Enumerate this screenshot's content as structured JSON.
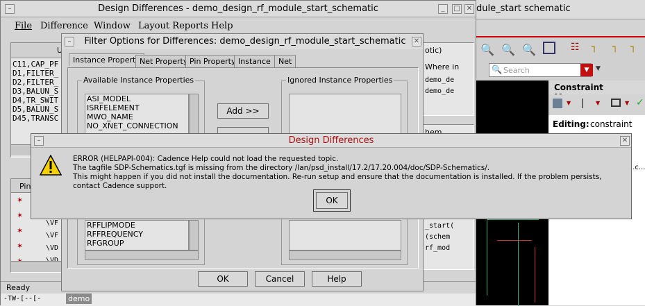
{
  "main_window": {
    "title": "Design Differences - demo_design_rf_module_start_schematic",
    "menu": [
      "File",
      "Difference",
      "Window",
      "Layout Reports",
      "Help"
    ],
    "left_col_header": "U",
    "instances": [
      "C11,CAP_PF",
      "D1,FILTER_",
      "D2,FILTER_",
      "D3,BALUN_S",
      "D4,TR_SWIT",
      "D5,BALUN_S",
      "D45,TRANSC"
    ],
    "pin_header": "Pin",
    "pin_rows": [
      "\\VF",
      "\\VF",
      "\\VD",
      "\\VD"
    ],
    "status": "Ready",
    "right_col_header": "otic)",
    "where_header": "Where in",
    "where_rows": [
      "demo_de",
      "demo_de"
    ],
    "right_lower_header": "hem",
    "lower_right_rows": [
      "_start(",
      "(schem",
      "rf_mod"
    ],
    "taskbar_text": "-TW-[--[-",
    "taskbar_tab": "demo"
  },
  "background_app": {
    "title_fragment": "dule_start schematic",
    "search_placeholder": "Search",
    "panel_title": "Constraint Manager",
    "editing_label": "Editing:",
    "editing_value": "constraint",
    "right_snippet": "..c..."
  },
  "filter_dialog": {
    "title": "Filter Options for Differences: demo_design_rf_module_start_schematic",
    "tabs": [
      "Instance Property",
      "Net Property",
      "Pin Property",
      "Instance",
      "Net"
    ],
    "available_label": "Available Instance Properties",
    "ignored_label": "Ignored Instance Properties",
    "available_top": [
      "ASI_MODEL",
      "ISRFELEMENT",
      "MWO_NAME",
      "NO_XNET_CONNECTION"
    ],
    "available_bottom": [
      "RFFLIPMODE",
      "RFFREQUENCY",
      "RFGROUP"
    ],
    "add_button": "Add >>",
    "ok": "OK",
    "cancel": "Cancel",
    "help": "Help"
  },
  "error_dialog": {
    "title": "Design Differences",
    "line1": "ERROR (HELPAPI-004): Cadence Help could not load the requested topic.",
    "line2": "The tagfile SDP-Schematics.tgf is missing from the directory /lan/psd_install/17.2/17.20.004/doc/SDP-Schematics/.",
    "line3": "This might happen if you did not install the documentation. Re-run setup and ensure that the documentation is installed. If the problem persists, contact Cadence support.",
    "ok": "OK"
  }
}
